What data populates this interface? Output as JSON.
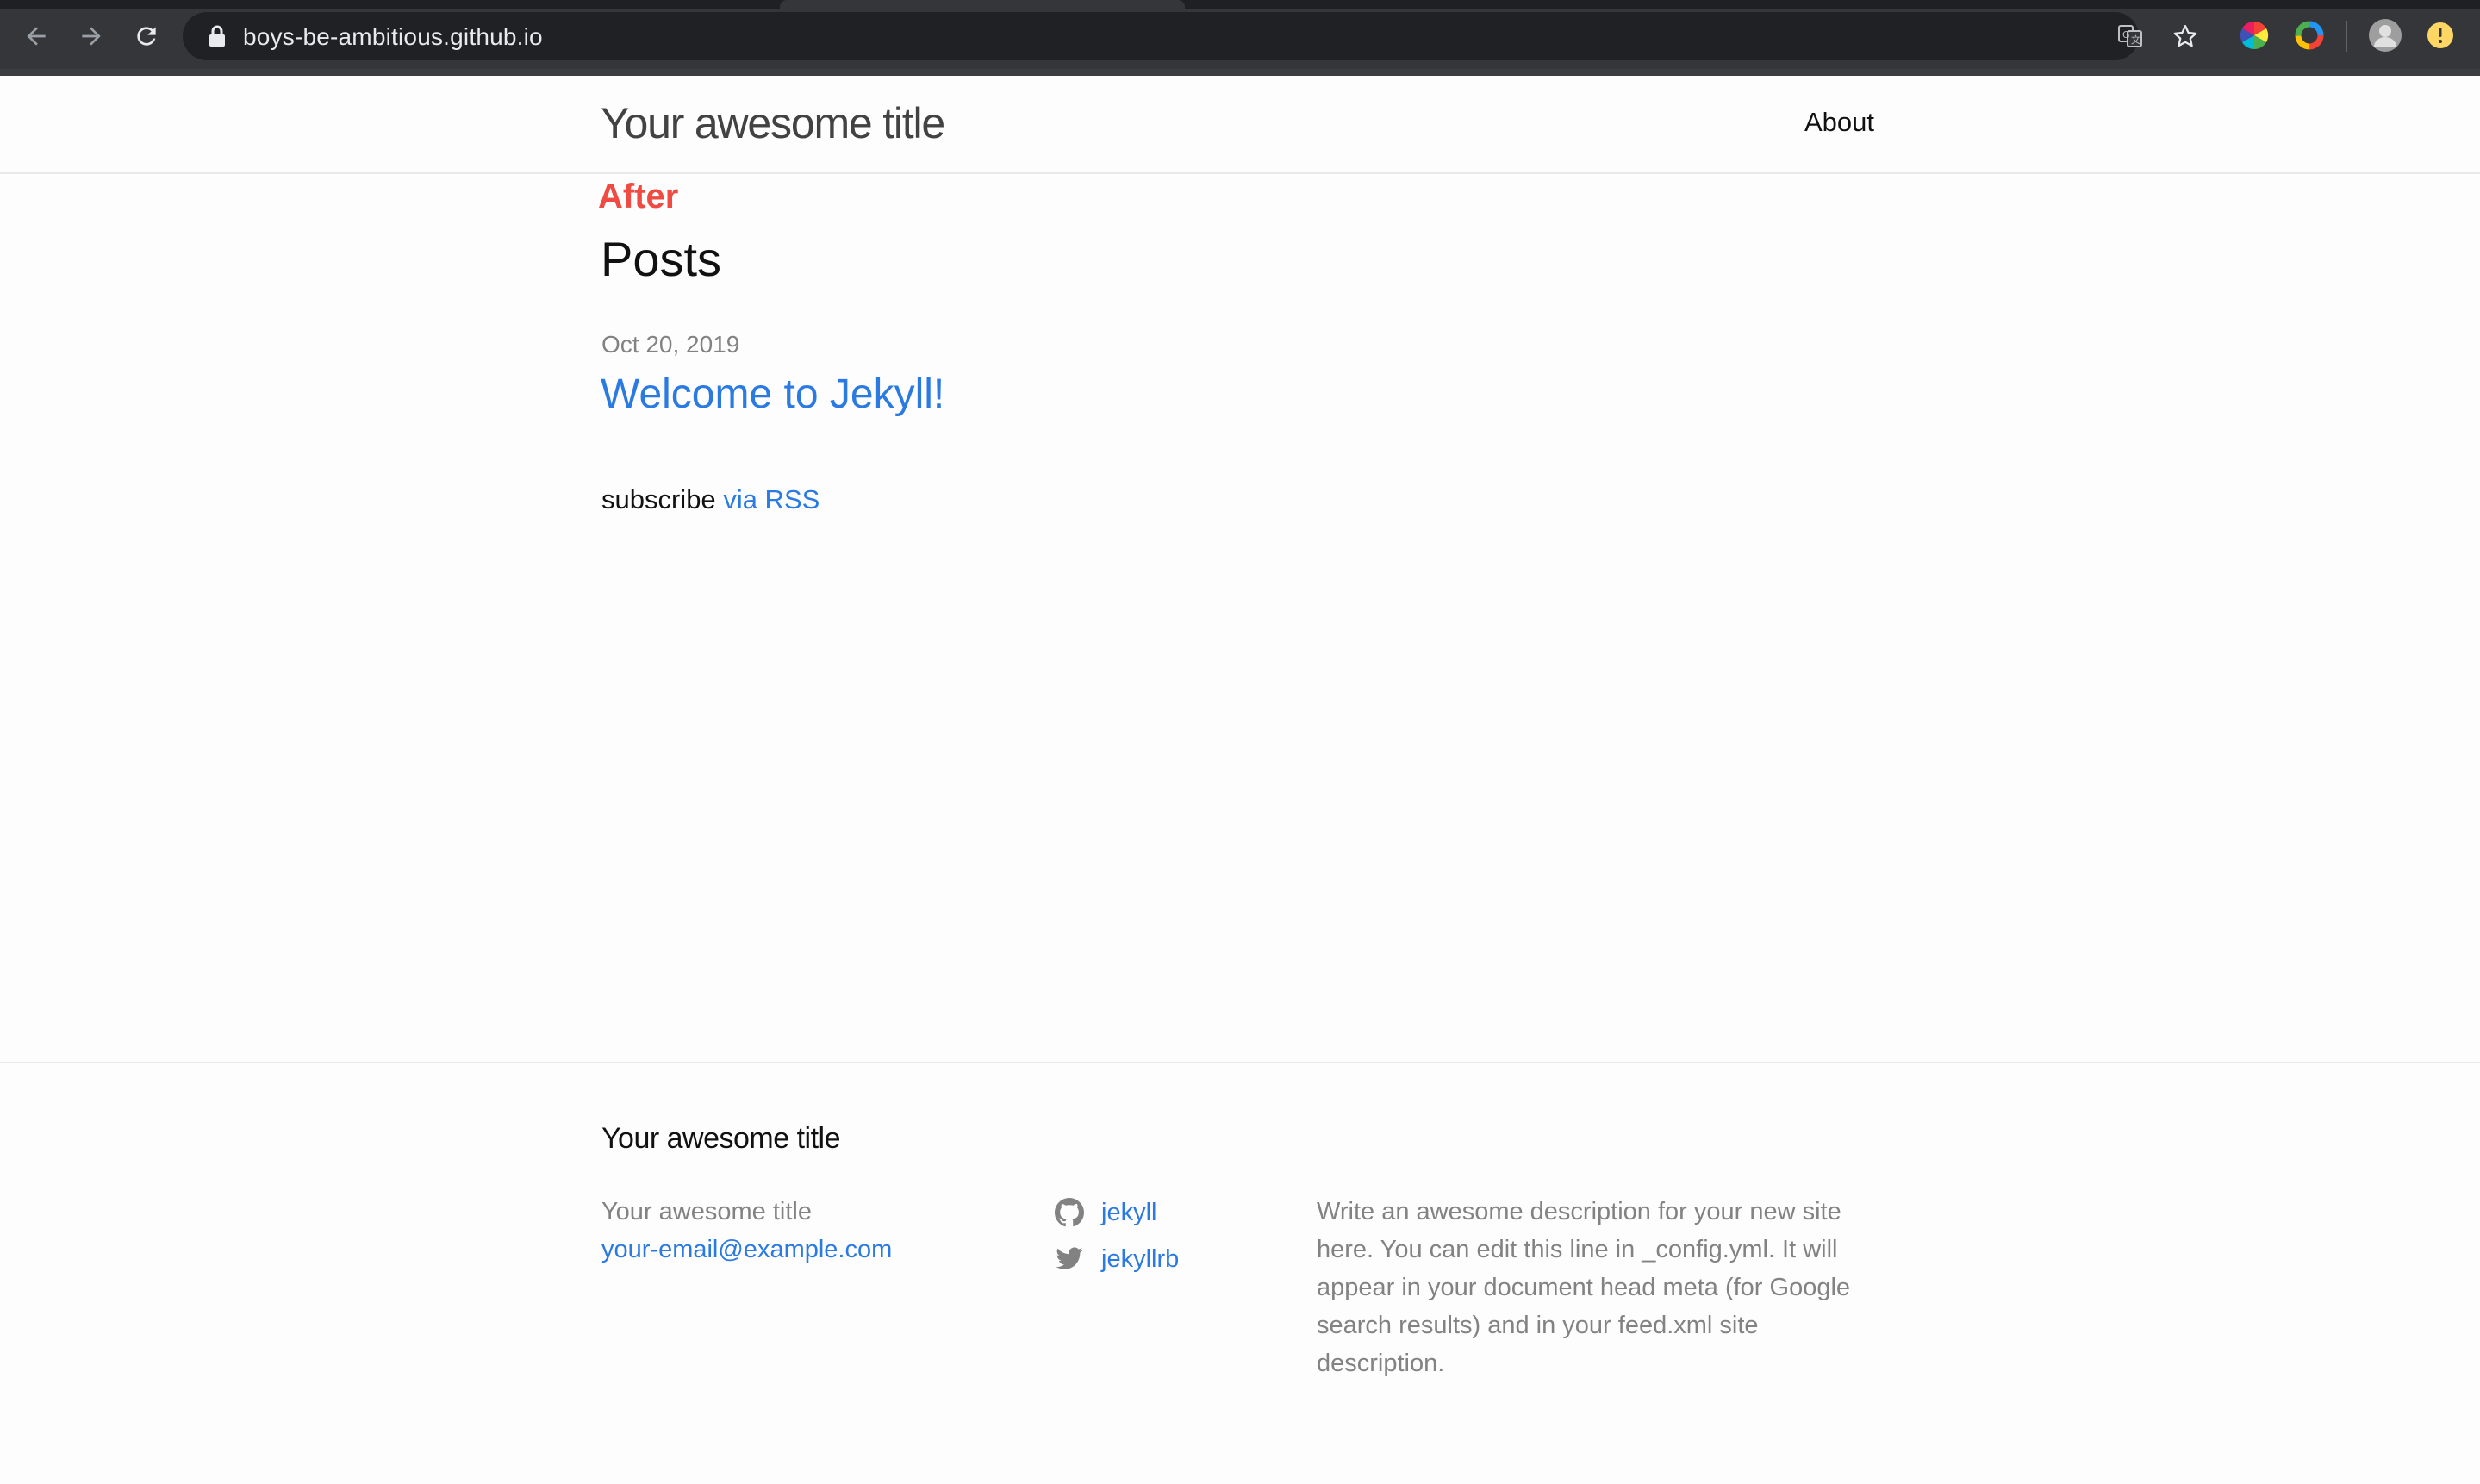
{
  "browser": {
    "url": "boys-be-ambitious.github.io",
    "icons": {
      "back": "arrow-left-icon",
      "forward": "arrow-right-icon",
      "reload": "reload-icon",
      "lock": "lock-icon",
      "translate": "translate-icon",
      "bookmark": "star-icon",
      "extension1": "colorwheel-icon",
      "extension2": "color-ring-icon",
      "profile": "avatar-icon",
      "update": "update-icon"
    }
  },
  "header": {
    "site_title": "Your awesome title",
    "nav": {
      "about_label": "About"
    }
  },
  "annotation": {
    "label": "After",
    "color": "#ef4b43"
  },
  "main": {
    "heading": "Posts",
    "posts": [
      {
        "date": "Oct 20, 2019",
        "title": "Welcome to Jekyll!"
      }
    ],
    "subscribe_text": "subscribe",
    "rss_label": "via RSS"
  },
  "footer": {
    "heading": "Your awesome title",
    "name": "Your awesome title",
    "email": "your-email@example.com",
    "github_username": "jekyll",
    "twitter_username": "jekyllrb",
    "description": "Write an awesome description for your new site here. You can edit this line in _config.yml. It will appear in your document head meta (for Google search results) and in your feed.xml site description."
  },
  "colors": {
    "link": "#2a7ae2",
    "text": "#111111",
    "muted": "#828282",
    "chrome_bg": "#35363a",
    "omnibox_bg": "#202124"
  }
}
